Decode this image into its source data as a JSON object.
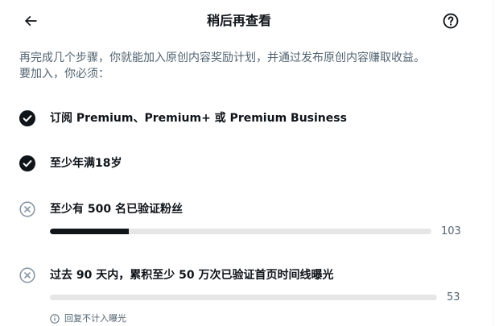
{
  "header": {
    "title": "稍后再查看"
  },
  "intro": {
    "line1": "再完成几个步骤，你就能加入原创内容奖励计划，并通过发布原创内容赚取收益。",
    "line2": "要加入，你必须："
  },
  "requirements": [
    {
      "label": "订阅 Premium、Premium+ 或 Premium Business",
      "status": "complete"
    },
    {
      "label": "至少年满18岁",
      "status": "complete"
    },
    {
      "label": "至少有 500 名已验证粉丝",
      "status": "incomplete",
      "progress_value": "103",
      "progress": 0.206
    },
    {
      "label": "过去 90 天内，累积至少 50 万次已验证首页时间线曝光",
      "status": "incomplete",
      "progress_value": "53",
      "progress": 0.0001
    }
  ],
  "note": {
    "text": "回复不计入曝光"
  },
  "colors": {
    "text_primary": "#0f1419",
    "text_secondary": "#536471",
    "progress_fill": "#0f1419",
    "progress_track": "#e6e6e6",
    "incomplete_icon": "#8b98a5"
  },
  "icons": {
    "back": "arrow-left-icon",
    "help": "question-circle-icon",
    "complete": "check-circle-icon",
    "incomplete": "x-circle-icon",
    "info": "info-circle-icon"
  }
}
